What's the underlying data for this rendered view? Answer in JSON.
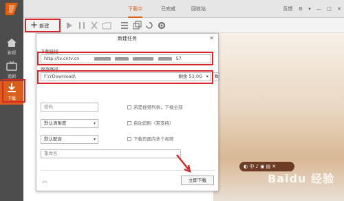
{
  "sidebar": {
    "items": [
      {
        "label": "影视"
      },
      {
        "label": "追剧"
      },
      {
        "label": "下载"
      }
    ]
  },
  "tabs": [
    {
      "label": "下载中"
    },
    {
      "label": "已完成"
    },
    {
      "label": "回收站"
    }
  ],
  "window_controls": {
    "feedback": "反馈"
  },
  "toolbar": {
    "new_label": "新建"
  },
  "dialog": {
    "title": "新建任务",
    "url_label": "下载链接",
    "url_value": "http://tv.cntv.cn",
    "url_suffix": "57",
    "path_label": "保存路径",
    "path_value": "F:\\YDownload\\",
    "free_space": "剩余 53.0G",
    "password_placeholder": "密码",
    "quality_value": "默认清晰度",
    "audio_value": "默认配音",
    "rename_placeholder": "重命名",
    "chk_album": "若是视频列表，下载全部",
    "chk_subtitle": "自动追剧（若支持）",
    "chk_multi": "下载页面内多个视频",
    "download_button": "立即下载"
  },
  "overlay": {
    "text": "Baidu 经验"
  },
  "colors": {
    "accent": "#e06010",
    "highlight": "#d8262b",
    "sidebar": "#4d4d4d"
  }
}
